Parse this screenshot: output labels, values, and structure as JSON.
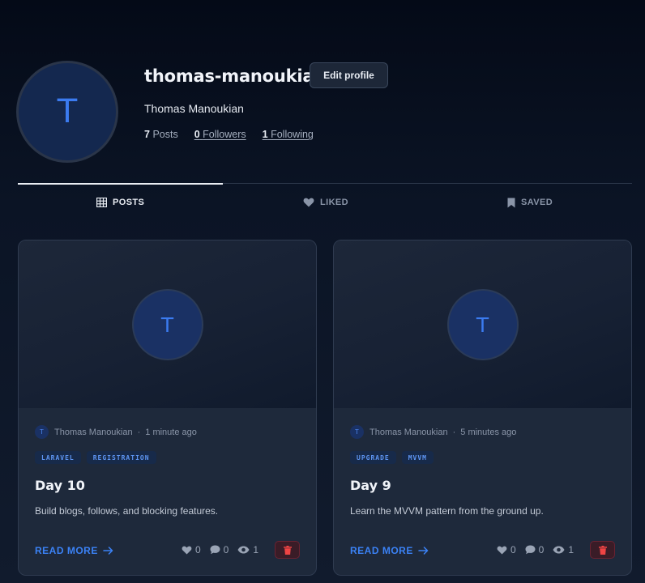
{
  "profile": {
    "avatar_initial": "T",
    "username": "thomas-manoukian",
    "edit_label": "Edit profile",
    "full_name": "Thomas Manoukian",
    "stats": {
      "posts_count": "7",
      "posts_label": "Posts",
      "followers_count": "0",
      "followers_label": "Followers",
      "following_count": "1",
      "following_label": "Following"
    }
  },
  "tabs": [
    {
      "label": "POSTS",
      "icon": "grid-icon",
      "active": true
    },
    {
      "label": "LIKED",
      "icon": "heart-icon",
      "active": false
    },
    {
      "label": "SAVED",
      "icon": "bookmark-icon",
      "active": false
    }
  ],
  "posts": [
    {
      "cover_initial": "T",
      "author_initial": "T",
      "author": "Thomas Manoukian",
      "separator": "·",
      "time": "1 minute ago",
      "tags": [
        "LARAVEL",
        "REGISTRATION"
      ],
      "title": "Day 10",
      "excerpt": "Build blogs, follows, and blocking features.",
      "read_more": "READ MORE",
      "likes": "0",
      "comments": "0",
      "views": "1"
    },
    {
      "cover_initial": "T",
      "author_initial": "T",
      "author": "Thomas Manoukian",
      "separator": "·",
      "time": "5 minutes ago",
      "tags": [
        "UPGRADE",
        "MVVM"
      ],
      "title": "Day 9",
      "excerpt": "Learn the MVVM pattern from the ground up.",
      "read_more": "READ MORE",
      "likes": "0",
      "comments": "0",
      "views": "1"
    }
  ],
  "colors": {
    "accent": "#3b82f6",
    "delete": "#ef4444",
    "card_bg": "#1e293b"
  }
}
